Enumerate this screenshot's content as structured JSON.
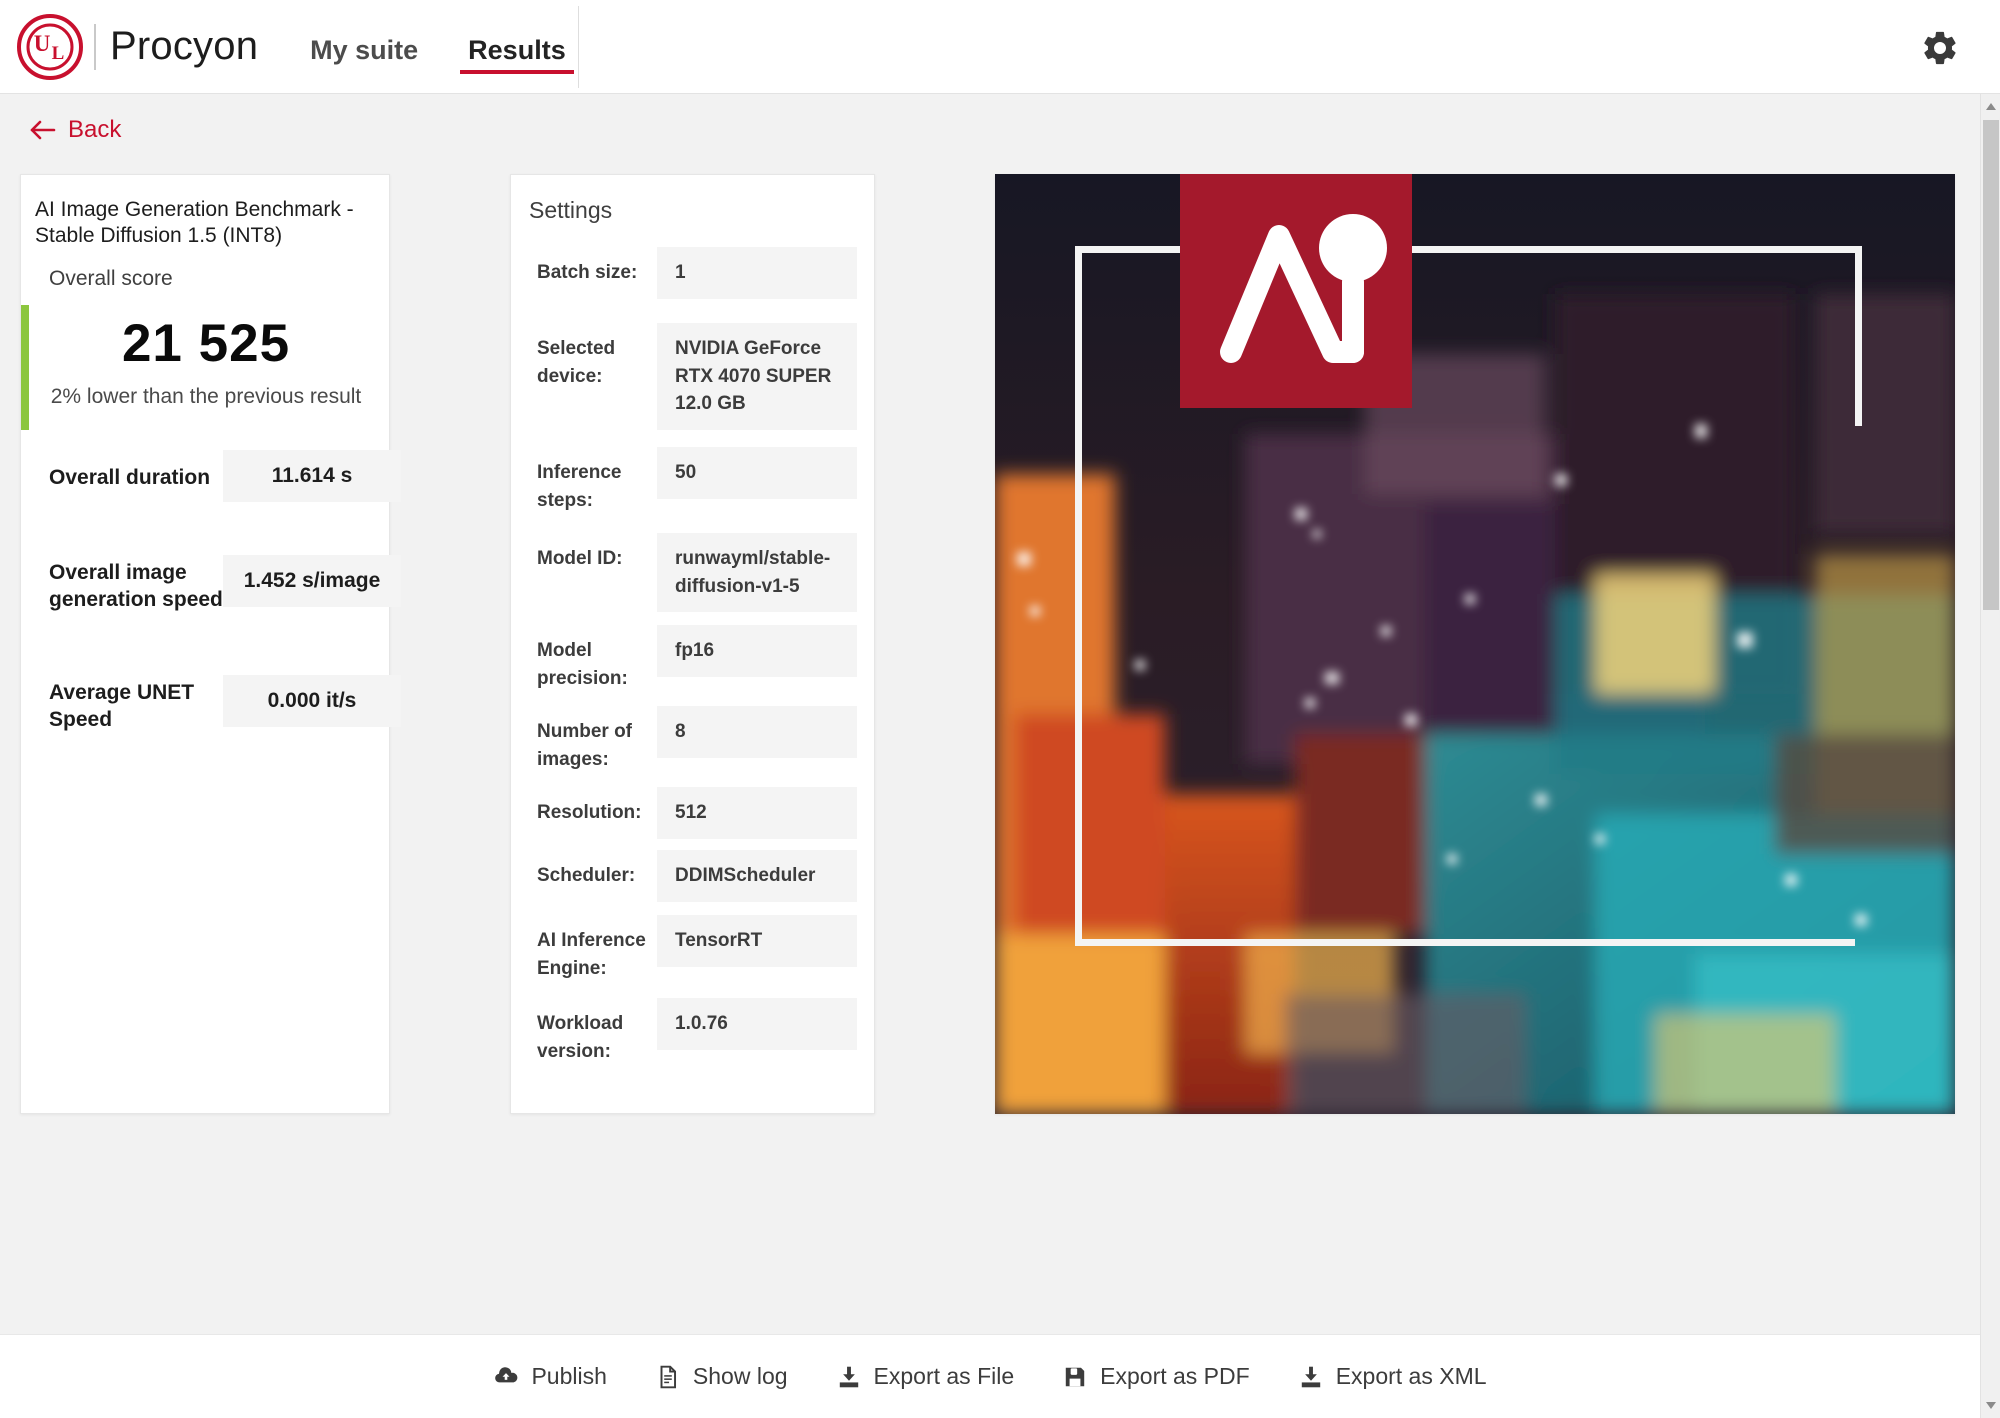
{
  "header": {
    "logo_text_u": "U",
    "logo_text_l": "L",
    "brand": "Procyon",
    "tabs": [
      {
        "label": "My suite",
        "active": false
      },
      {
        "label": "Results",
        "active": true
      }
    ],
    "settings_icon": "gear-icon"
  },
  "back": {
    "label": "Back",
    "icon": "arrow-left-icon"
  },
  "score_panel": {
    "benchmark_title": "AI Image Generation Benchmark - Stable Diffusion 1.5 (INT8)",
    "overall_score_label": "Overall score",
    "score": "21 525",
    "comparison": "2% lower than the previous result",
    "accent_color": "#8cc63e",
    "metrics": [
      {
        "label": "Overall duration",
        "value": "11.614 s"
      },
      {
        "label": "Overall image generation speed",
        "value": "1.452 s/image"
      },
      {
        "label": "Average UNET Speed",
        "value": "0.000 it/s"
      }
    ]
  },
  "settings_panel": {
    "title": "Settings",
    "rows": [
      {
        "label": "Batch size:",
        "value": "1"
      },
      {
        "label": "Selected device:",
        "value": "NVIDIA GeForce RTX 4070 SUPER 12.0 GB"
      },
      {
        "label": "Inference steps:",
        "value": "50"
      },
      {
        "label": "Model ID:",
        "value": "runwayml/stable-diffusion-v1-5"
      },
      {
        "label": "Model precision:",
        "value": "fp16"
      },
      {
        "label": "Number of images:",
        "value": "8"
      },
      {
        "label": "Resolution:",
        "value": "512"
      },
      {
        "label": "Scheduler:",
        "value": "DDIMScheduler"
      },
      {
        "label": "AI Inference Engine:",
        "value": "TensorRT"
      },
      {
        "label": "Workload version:",
        "value": "1.0.76"
      }
    ]
  },
  "image_panel": {
    "badge_icon": "ai-logo-icon",
    "badge_color": "#a4192c",
    "preview_name": "generated-image-preview"
  },
  "footer": {
    "buttons": [
      {
        "label": "Publish",
        "icon": "cloud-upload-icon"
      },
      {
        "label": "Show log",
        "icon": "document-icon"
      },
      {
        "label": "Export as File",
        "icon": "download-icon"
      },
      {
        "label": "Export as PDF",
        "icon": "save-disk-icon"
      },
      {
        "label": "Export as XML",
        "icon": "download-icon"
      }
    ]
  },
  "colors": {
    "brand_red": "#c8102e",
    "badge_red": "#a4192c",
    "green_accent": "#8cc63e",
    "page_bg": "#f2f2f2"
  }
}
